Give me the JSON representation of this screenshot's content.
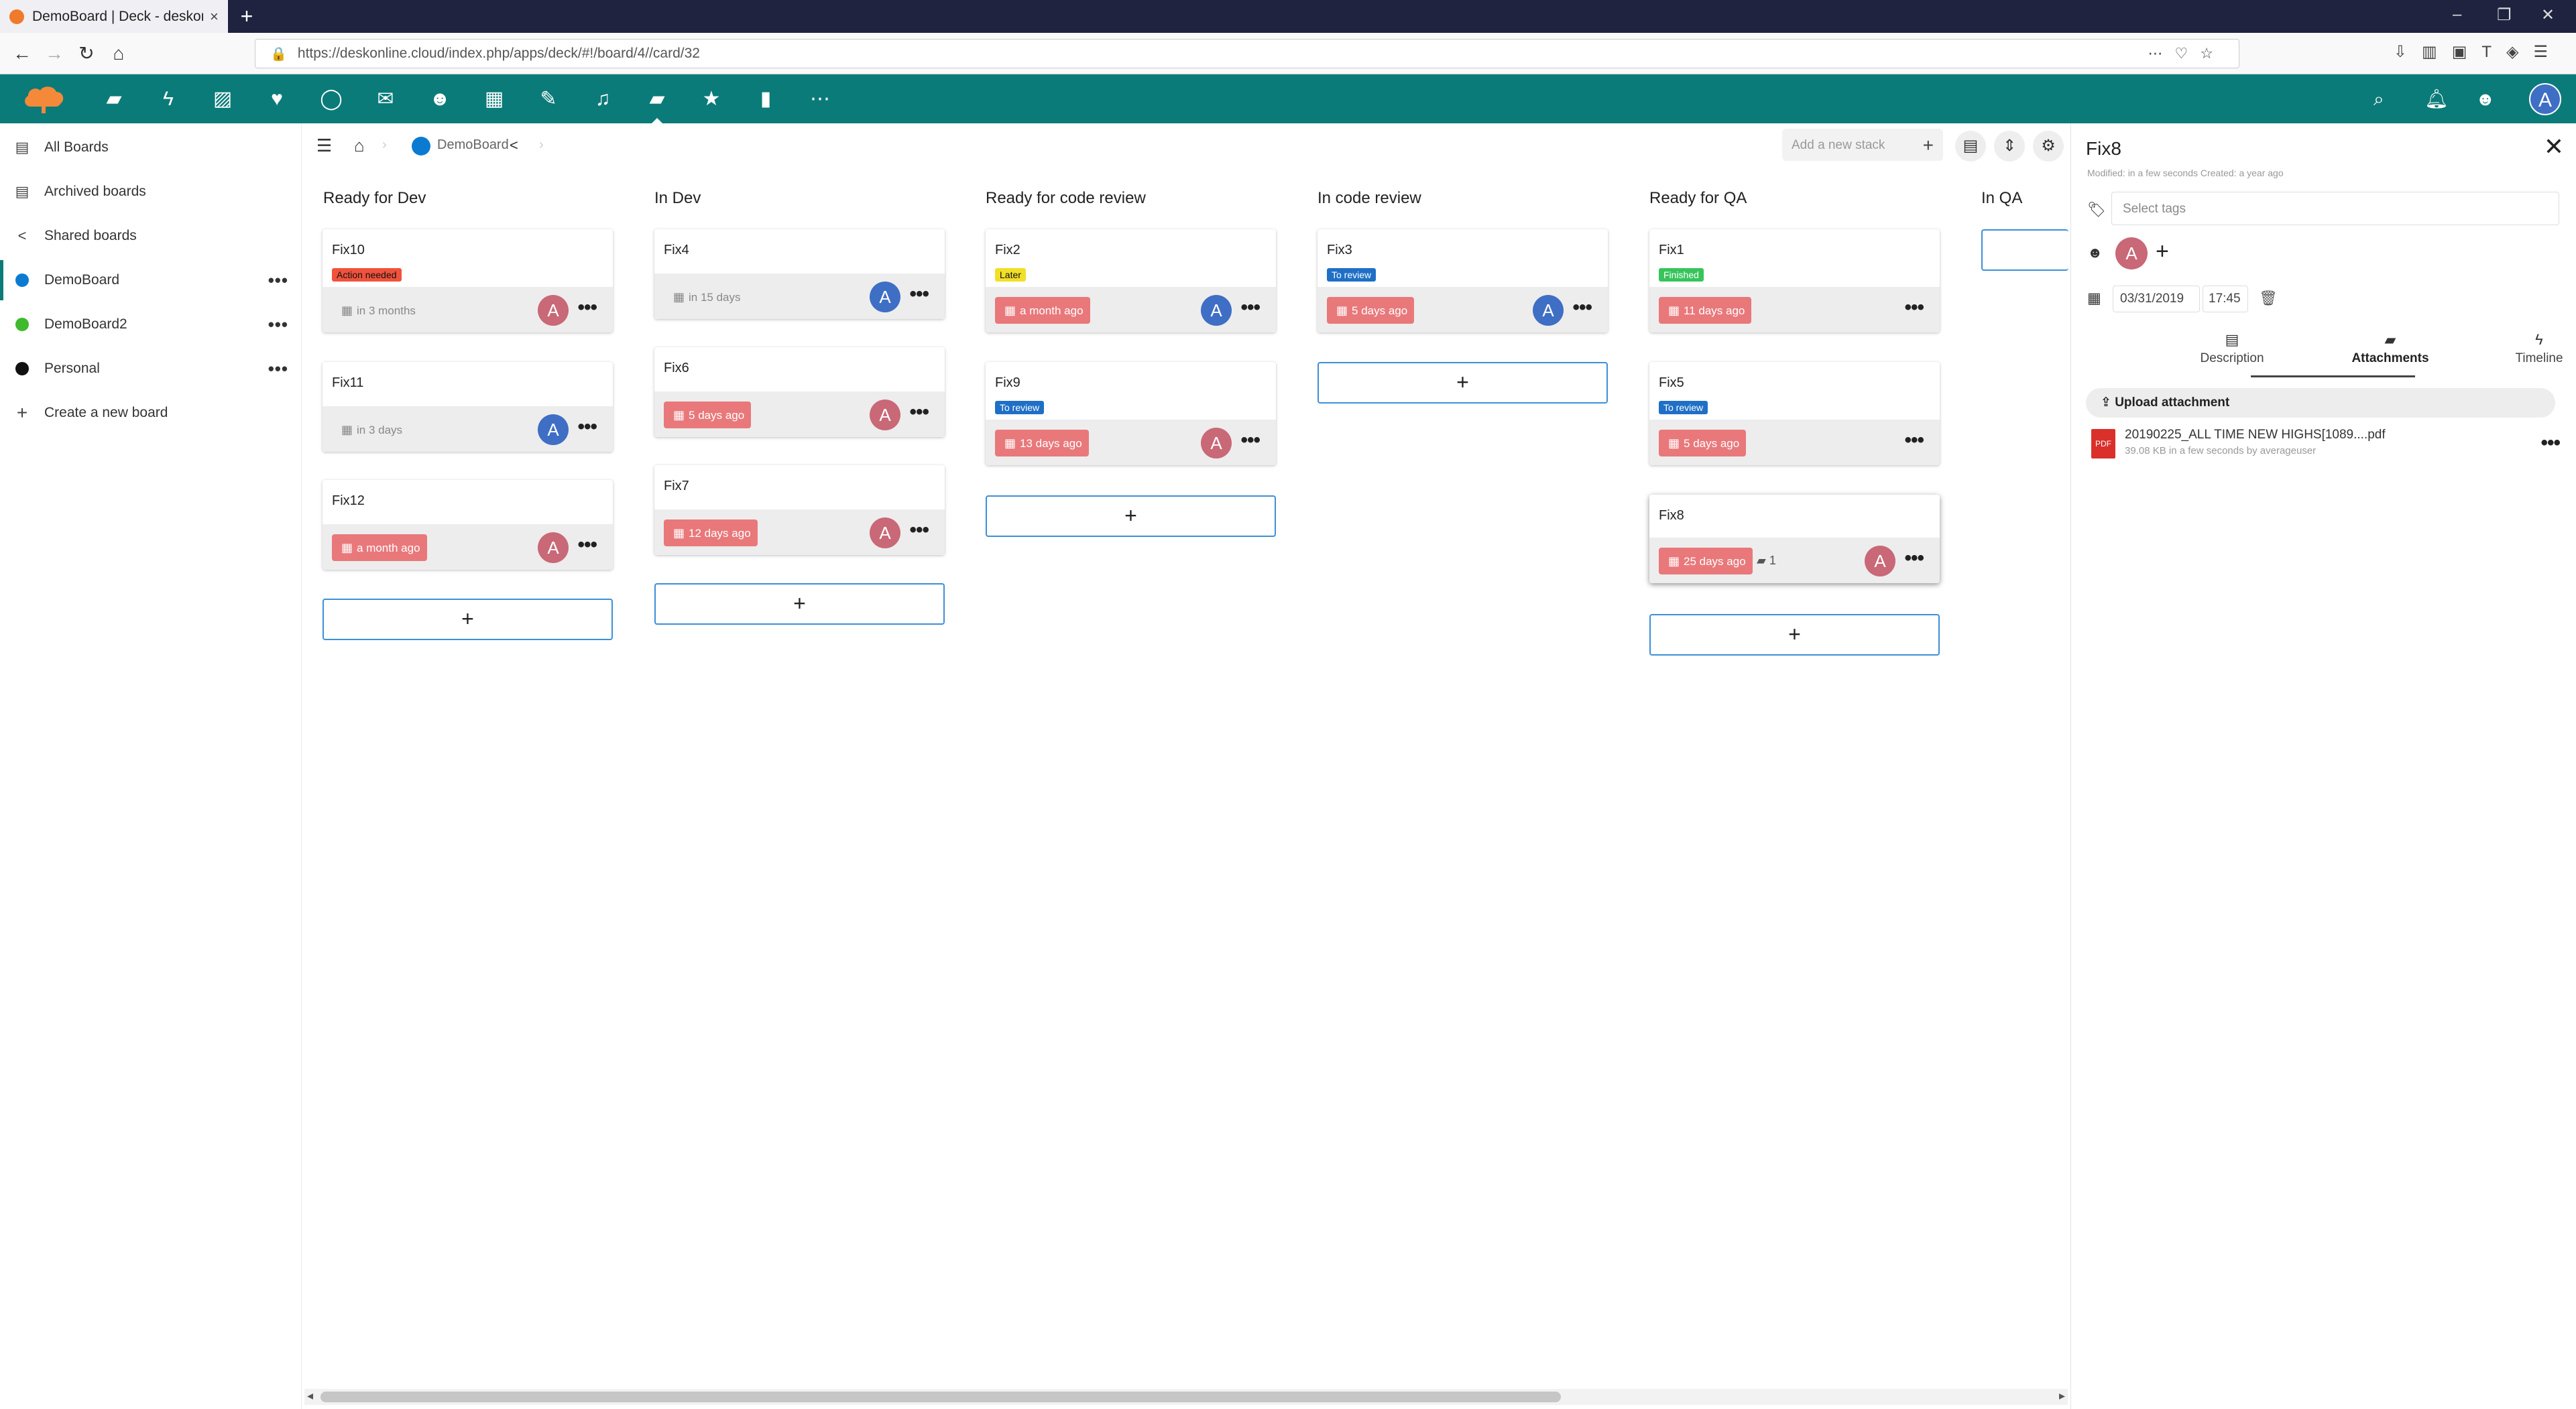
{
  "browser": {
    "tab_title": "DemoBoard | Deck - deskonline",
    "tab_close": "×",
    "new_tab": "+",
    "url": "https://deskonline.cloud/index.php/apps/deck/#!/board/4//card/32",
    "window_controls": [
      "–",
      "❐",
      "✕"
    ]
  },
  "header": {
    "apps": [
      "files-icon",
      "activity-icon",
      "photos-icon",
      "favorites-icon",
      "search-talk-icon",
      "mail-icon",
      "contacts-icon",
      "calendar-icon",
      "notes-icon",
      "music-icon",
      "deck-icon",
      "bookmarks-icon",
      "analytics-icon",
      "more-apps-icon"
    ],
    "avatar_letter": "A"
  },
  "sidebar": {
    "items": [
      {
        "label": "All Boards",
        "icon": "archive-icon"
      },
      {
        "label": "Archived boards",
        "icon": "archive-icon"
      },
      {
        "label": "Shared boards",
        "icon": "share-icon"
      },
      {
        "label": "DemoBoard",
        "color": "#0b7bd1",
        "more": "•••"
      },
      {
        "label": "DemoBoard2",
        "color": "#3fba2d",
        "more": "•••"
      },
      {
        "label": "Personal",
        "color": "#111111",
        "more": "•••"
      },
      {
        "label": "Create a new board",
        "icon": "plus-icon"
      }
    ]
  },
  "board": {
    "name": "DemoBoard",
    "add_stack_placeholder": "Add a new stack",
    "stacks": [
      {
        "title": "Ready for Dev"
      },
      {
        "title": "In Dev"
      },
      {
        "title": "Ready for code review"
      },
      {
        "title": "In code review"
      },
      {
        "title": "Ready for QA"
      },
      {
        "title": "In QA"
      }
    ],
    "cards": {
      "fix10": {
        "title": "Fix10",
        "label": "Action needed",
        "due": "in 3 months",
        "avatar": "A"
      },
      "fix11": {
        "title": "Fix11",
        "due": "in 3 days",
        "avatar": "A"
      },
      "fix12": {
        "title": "Fix12",
        "due": "a month ago",
        "avatar": "A"
      },
      "fix4": {
        "title": "Fix4",
        "due": "in 15 days",
        "avatar": "A"
      },
      "fix6": {
        "title": "Fix6",
        "due": "5 days ago",
        "avatar": "A"
      },
      "fix7": {
        "title": "Fix7",
        "due": "12 days ago",
        "avatar": "A"
      },
      "fix2": {
        "title": "Fix2",
        "label": "Later",
        "due": "a month ago",
        "avatar": "A"
      },
      "fix9": {
        "title": "Fix9",
        "label": "To review",
        "due": "13 days ago",
        "avatar": "A"
      },
      "fix3": {
        "title": "Fix3",
        "label": "To review",
        "due": "5 days ago",
        "avatar": "A"
      },
      "fix1": {
        "title": "Fix1",
        "label": "Finished",
        "due": "11 days ago"
      },
      "fix5": {
        "title": "Fix5",
        "label": "To review",
        "due": "5 days ago"
      },
      "fix8": {
        "title": "Fix8",
        "due": "25 days ago",
        "attachments": "1",
        "avatar": "A"
      }
    },
    "more": "•••",
    "add_card": "+"
  },
  "colors": {
    "header": "#0b7b79",
    "overdue": "#e9787b",
    "label_action_needed": "#f0523c",
    "label_later": "#f2df28",
    "label_to_review": "#1f6fc6",
    "label_finished": "#37c45b",
    "avatar_pink": "#c96877",
    "avatar_blue": "#3f6ec5"
  },
  "details": {
    "title": "Fix8",
    "close": "✕",
    "meta": "Modified: in a few seconds Created: a year ago",
    "tags_placeholder": "Select tags",
    "assignee": "A",
    "add_assignee": "+",
    "due_date": "03/31/2019",
    "due_time": "17:45",
    "tabs": [
      "Description",
      "Attachments",
      "Timeline"
    ],
    "upload_label": "Upload attachment",
    "attachment": {
      "name": "20190225_ALL TIME NEW HIGHS[1089....pdf",
      "meta": "39.08 KB in a few seconds by averageuser"
    },
    "more": "•••"
  }
}
